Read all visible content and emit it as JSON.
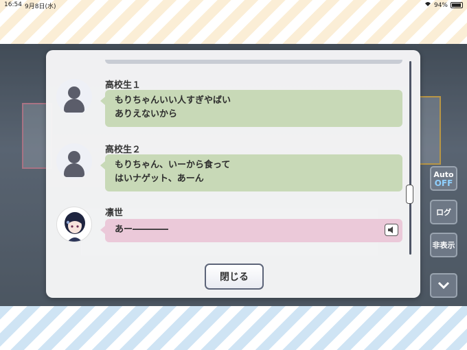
{
  "status": {
    "time": "16:54",
    "date": "9月8日(水)",
    "battery": "94%",
    "battery_level": 0.94
  },
  "side_buttons": {
    "auto": "Auto",
    "auto_state": "OFF",
    "log": "ログ",
    "hide": "非表示"
  },
  "log": {
    "entries": [
      {
        "speaker": "高校生１",
        "lines": [
          "もりちゃんいい人すぎやばい",
          "ありえないから"
        ],
        "color": "green",
        "avatar": "silhouette-icon"
      },
      {
        "speaker": "高校生２",
        "lines": [
          "もりちゃん、いーから食って",
          "はいナゲット、あーん"
        ],
        "color": "green",
        "avatar": "silhouette-icon"
      },
      {
        "speaker": "凛世",
        "lines": [
          "あー――――"
        ],
        "color": "pink",
        "avatar": "rinze-portrait",
        "voice": "speaker-icon"
      }
    ],
    "close_label": "閉じる"
  },
  "colors": {
    "green_bubble": "#c8d9b7",
    "pink_bubble": "#ebc9d9"
  }
}
